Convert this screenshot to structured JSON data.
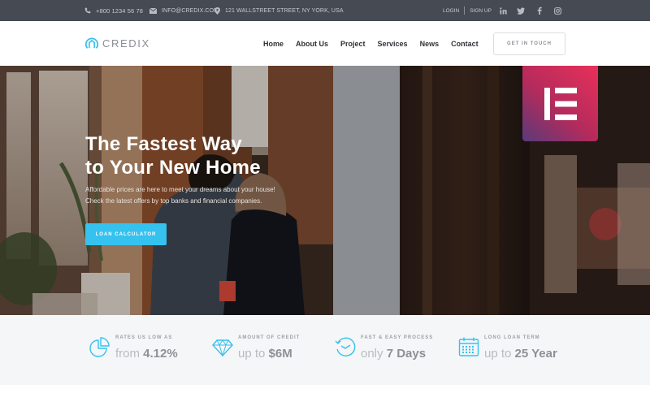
{
  "topbar": {
    "phone": "+800 1234 56 78",
    "email": "INFO@CREDIX.COM",
    "address": "121 WALLSTREET STREET, NY YORK, USA",
    "login": "LOGIN",
    "signup": "SIGN UP",
    "social": [
      "linkedin-icon",
      "twitter-icon",
      "facebook-icon",
      "instagram-icon"
    ]
  },
  "header": {
    "logo_text": "CREDIX",
    "nav": [
      {
        "label": "Home"
      },
      {
        "label": "About Us"
      },
      {
        "label": "Project"
      },
      {
        "label": "Services"
      },
      {
        "label": "News"
      },
      {
        "label": "Contact"
      }
    ],
    "cta_label": "GET IN TOUCH"
  },
  "hero": {
    "title_line1": "The Fastest Way",
    "title_line2": "to Your New Home",
    "subtitle_line1": "Affordable prices are here to meet your dreams about your house!",
    "subtitle_line2": "Check the latest offers by top banks and financial companies.",
    "button_label": "LOAN CALCULATOR",
    "badge": "elementor-logo-icon"
  },
  "features": [
    {
      "icon": "pie-chart-icon",
      "label": "RATES US LOW AS",
      "prefix": "from",
      "value": "4.12%"
    },
    {
      "icon": "diamond-icon",
      "label": "AMOUNT OF CREDIT",
      "prefix": "up to",
      "value": "$6M"
    },
    {
      "icon": "clock-history-icon",
      "label": "FAST & EASY PROCESS",
      "prefix": "only",
      "value": "7 Days"
    },
    {
      "icon": "calendar-icon",
      "label": "LONG LOAN TERM",
      "prefix": "up to",
      "value": "25 Year"
    }
  ],
  "colors": {
    "accent": "#35c2ef",
    "topbar_bg": "#464a52",
    "features_bg": "#f5f6f8",
    "badge_from": "#e8305a",
    "badge_to": "#5a3a7a"
  }
}
